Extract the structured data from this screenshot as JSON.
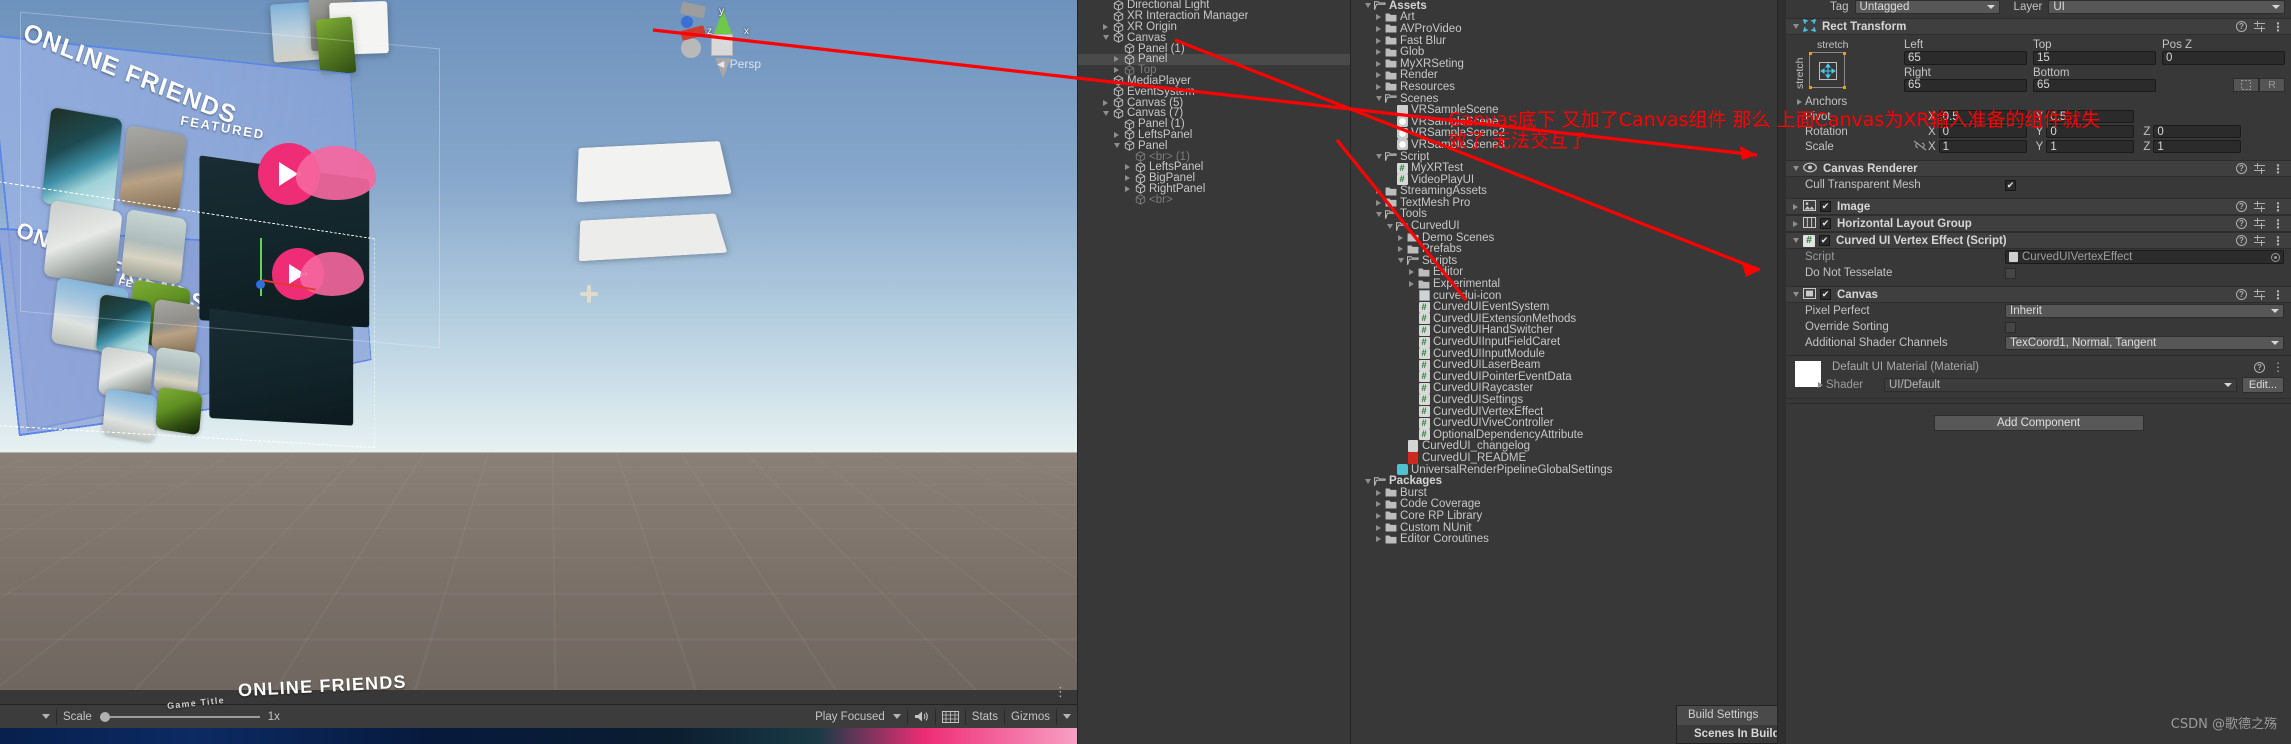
{
  "scene_view": {
    "labels": {
      "online_friends_1": "ONLINE FRIENDS",
      "online_friends_2": "ONLINE FRIENDS",
      "online_friends_bottom": "ONLINE FRIENDS",
      "featured_1": "FEATURED",
      "featured_2": "FEATURED",
      "game_title": "Game Title"
    },
    "view_gizmo": {
      "mode": "Persp",
      "axis_x": "x",
      "axis_y": "y",
      "axis_z": "z"
    },
    "toolbar": {
      "scale_label": "Scale",
      "scale_value": "1x",
      "aspect": "Play Focused",
      "stats": "Stats",
      "gizmos": "Gizmos"
    }
  },
  "hierarchy": {
    "items": [
      {
        "label": "Directional Light",
        "indent": 2,
        "twisty": "none",
        "dim": false,
        "selected": false
      },
      {
        "label": "XR Interaction Manager",
        "indent": 2,
        "twisty": "none",
        "dim": false,
        "selected": false
      },
      {
        "label": "XR Origin",
        "indent": 2,
        "twisty": "right",
        "dim": false,
        "selected": false
      },
      {
        "label": "Canvas",
        "indent": 2,
        "twisty": "down",
        "dim": false,
        "selected": false
      },
      {
        "label": "Panel (1)",
        "indent": 3,
        "twisty": "none",
        "dim": false,
        "selected": false
      },
      {
        "label": "Panel",
        "indent": 3,
        "twisty": "right",
        "dim": false,
        "selected": true
      },
      {
        "label": "Top",
        "indent": 3,
        "twisty": "right",
        "dim": true,
        "selected": false
      },
      {
        "label": "MediaPlayer",
        "indent": 2,
        "twisty": "none",
        "dim": false,
        "selected": false
      },
      {
        "label": "EventSystem",
        "indent": 2,
        "twisty": "none",
        "dim": false,
        "selected": false
      },
      {
        "label": "Canvas (5)",
        "indent": 2,
        "twisty": "right",
        "dim": false,
        "selected": false
      },
      {
        "label": "Canvas (7)",
        "indent": 2,
        "twisty": "down",
        "dim": false,
        "selected": false
      },
      {
        "label": "Panel (1)",
        "indent": 3,
        "twisty": "none",
        "dim": false,
        "selected": false
      },
      {
        "label": "LeftsPanel",
        "indent": 3,
        "twisty": "right",
        "dim": false,
        "selected": false
      },
      {
        "label": "Panel",
        "indent": 3,
        "twisty": "down",
        "dim": false,
        "selected": false
      },
      {
        "label": "<br> (1)",
        "indent": 4,
        "twisty": "none",
        "dim": true,
        "selected": false
      },
      {
        "label": "LeftsPanel",
        "indent": 4,
        "twisty": "right",
        "dim": false,
        "selected": false
      },
      {
        "label": "BigPanel",
        "indent": 4,
        "twisty": "right",
        "dim": false,
        "selected": false
      },
      {
        "label": "RightPanel",
        "indent": 4,
        "twisty": "right",
        "dim": false,
        "selected": false
      },
      {
        "label": "<br>",
        "indent": 4,
        "twisty": "none",
        "dim": true,
        "selected": false
      }
    ]
  },
  "project": {
    "items": [
      {
        "label": "Assets",
        "indent": 1,
        "twisty": "down",
        "icon": "folder-open",
        "bold": true
      },
      {
        "label": "Art",
        "indent": 2,
        "twisty": "right",
        "icon": "folder"
      },
      {
        "label": "AVProVideo",
        "indent": 2,
        "twisty": "right",
        "icon": "folder"
      },
      {
        "label": "Fast Blur",
        "indent": 2,
        "twisty": "right",
        "icon": "folder"
      },
      {
        "label": "Glob",
        "indent": 2,
        "twisty": "right",
        "icon": "folder"
      },
      {
        "label": "MyXRSeting",
        "indent": 2,
        "twisty": "right",
        "icon": "folder"
      },
      {
        "label": "Render",
        "indent": 2,
        "twisty": "right",
        "icon": "folder"
      },
      {
        "label": "Resources",
        "indent": 2,
        "twisty": "right",
        "icon": "folder"
      },
      {
        "label": "Scenes",
        "indent": 2,
        "twisty": "down",
        "icon": "folder-open"
      },
      {
        "label": "VRSampleScene",
        "indent": 3,
        "twisty": "none",
        "icon": "scene-alt"
      },
      {
        "label": "VRSampleScene",
        "indent": 3,
        "twisty": "none",
        "icon": "unity"
      },
      {
        "label": "VRSampleScene2",
        "indent": 3,
        "twisty": "none",
        "icon": "unity"
      },
      {
        "label": "VRSampleScene3",
        "indent": 3,
        "twisty": "none",
        "icon": "unity"
      },
      {
        "label": "Script",
        "indent": 2,
        "twisty": "down",
        "icon": "folder-open"
      },
      {
        "label": "MyXRTest",
        "indent": 3,
        "twisty": "none",
        "icon": "cs"
      },
      {
        "label": "VideoPlayUI",
        "indent": 3,
        "twisty": "none",
        "icon": "cs"
      },
      {
        "label": "StreamingAssets",
        "indent": 2,
        "twisty": "right",
        "icon": "folder"
      },
      {
        "label": "TextMesh Pro",
        "indent": 2,
        "twisty": "right",
        "icon": "folder"
      },
      {
        "label": "Tools",
        "indent": 2,
        "twisty": "down",
        "icon": "folder-open"
      },
      {
        "label": "CurvedUI",
        "indent": 3,
        "twisty": "down",
        "icon": "folder-open"
      },
      {
        "label": "Demo Scenes",
        "indent": 4,
        "twisty": "right",
        "icon": "folder"
      },
      {
        "label": "Prefabs",
        "indent": 4,
        "twisty": "right",
        "icon": "folder"
      },
      {
        "label": "Scripts",
        "indent": 4,
        "twisty": "down",
        "icon": "folder-open"
      },
      {
        "label": "Editor",
        "indent": 5,
        "twisty": "right",
        "icon": "folder"
      },
      {
        "label": "Experimental",
        "indent": 5,
        "twisty": "right",
        "icon": "folder"
      },
      {
        "label": "curvedui-icon",
        "indent": 5,
        "twisty": "none",
        "icon": "image"
      },
      {
        "label": "CurvedUIEventSystem",
        "indent": 5,
        "twisty": "none",
        "icon": "cs"
      },
      {
        "label": "CurvedUIExtensionMethods",
        "indent": 5,
        "twisty": "none",
        "icon": "cs"
      },
      {
        "label": "CurvedUIHandSwitcher",
        "indent": 5,
        "twisty": "none",
        "icon": "cs"
      },
      {
        "label": "CurvedUIInputFieldCaret",
        "indent": 5,
        "twisty": "none",
        "icon": "cs"
      },
      {
        "label": "CurvedUIInputModule",
        "indent": 5,
        "twisty": "none",
        "icon": "cs"
      },
      {
        "label": "CurvedUILaserBeam",
        "indent": 5,
        "twisty": "none",
        "icon": "cs"
      },
      {
        "label": "CurvedUIPointerEventData",
        "indent": 5,
        "twisty": "none",
        "icon": "cs"
      },
      {
        "label": "CurvedUIRaycaster",
        "indent": 5,
        "twisty": "none",
        "icon": "cs"
      },
      {
        "label": "CurvedUISettings",
        "indent": 5,
        "twisty": "none",
        "icon": "cs"
      },
      {
        "label": "CurvedUIVertexEffect",
        "indent": 5,
        "twisty": "none",
        "icon": "cs"
      },
      {
        "label": "CurvedUIViveController",
        "indent": 5,
        "twisty": "none",
        "icon": "cs"
      },
      {
        "label": "OptionalDependencyAttribute",
        "indent": 5,
        "twisty": "none",
        "icon": "cs"
      },
      {
        "label": "CurvedUI_changelog",
        "indent": 4,
        "twisty": "none",
        "icon": "doc"
      },
      {
        "label": "CurvedUI_README",
        "indent": 4,
        "twisty": "none",
        "icon": "pdf"
      },
      {
        "label": "UniversalRenderPipelineGlobalSettings",
        "indent": 3,
        "twisty": "none",
        "icon": "prefab"
      },
      {
        "label": "Packages",
        "indent": 1,
        "twisty": "down",
        "icon": "folder-open",
        "bold": true
      },
      {
        "label": "Burst",
        "indent": 2,
        "twisty": "right",
        "icon": "folder"
      },
      {
        "label": "Code Coverage",
        "indent": 2,
        "twisty": "right",
        "icon": "folder"
      },
      {
        "label": "Core RP Library",
        "indent": 2,
        "twisty": "right",
        "icon": "folder"
      },
      {
        "label": "Custom NUnit",
        "indent": 2,
        "twisty": "right",
        "icon": "folder"
      },
      {
        "label": "Editor Coroutines",
        "indent": 2,
        "twisty": "right",
        "icon": "folder"
      }
    ],
    "build_popup": {
      "title": "Build Settings",
      "section": "Scenes In Build"
    }
  },
  "inspector": {
    "tag_label": "Tag",
    "tag_value": "Untagged",
    "layer_label": "Layer",
    "layer_value": "UI",
    "rect_transform": {
      "title": "Rect Transform",
      "anchor_preset_top": "stretch",
      "anchor_preset_side": "stretch",
      "left_label": "Left",
      "left_value": "65",
      "top_label": "Top",
      "top_value": "15",
      "posz_label": "Pos Z",
      "posz_value": "0",
      "right_label": "Right",
      "right_value": "65",
      "bottom_label": "Bottom",
      "bottom_value": "65",
      "blueprint_btn": "R",
      "anchors_label": "Anchors",
      "pivot_label": "Pivot",
      "pivot_x": "0.5",
      "pivot_y": "0.5",
      "rotation_label": "Rotation",
      "rot_x": "0",
      "rot_y": "0",
      "rot_z": "0",
      "scale_label": "Scale",
      "scale_x": "1",
      "scale_y": "1",
      "scale_z": "1",
      "axis_x": "X",
      "axis_y": "Y",
      "axis_z": "Z"
    },
    "canvas_renderer": {
      "title": "Canvas Renderer",
      "cull_label": "Cull Transparent Mesh",
      "cull_checked": "✔"
    },
    "image_component": {
      "title": "Image",
      "checked": "✔"
    },
    "horizontal_layout_group": {
      "title": "Horizontal Layout Group",
      "checked": "✔"
    },
    "curved_ui_vertex_effect": {
      "title": "Curved UI Vertex Effect (Script)",
      "checked": "✔",
      "script_label": "Script",
      "script_value": "CurvedUIVertexEffect",
      "tessellate_label": "Do Not Tesselate"
    },
    "canvas": {
      "title": "Canvas",
      "checked": "✔",
      "pixel_perfect_label": "Pixel Perfect",
      "pixel_perfect_value": "Inherit",
      "override_sorting_label": "Override Sorting",
      "shader_channels_label": "Additional Shader Channels",
      "shader_channels_value": "TexCoord1, Normal, Tangent"
    },
    "material": {
      "title": "Default UI Material (Material)",
      "shader_label": "Shader",
      "shader_value": "UI/Default",
      "edit_label": "Edit..."
    },
    "add_component_label": "Add Component"
  },
  "annotations": {
    "line1": "Canvas底下 又加了Canvas组件 那么 上面Canvas为XR输入准备的组件就失",
    "line2": "效了 无法交互了"
  },
  "watermark": "CSDN @歌德之殇",
  "colors": {
    "accent_blue": "#5b86e8",
    "annotation_red": "#fe0000",
    "panel_bg": "#383838",
    "play_pink": "#ef2d76"
  }
}
